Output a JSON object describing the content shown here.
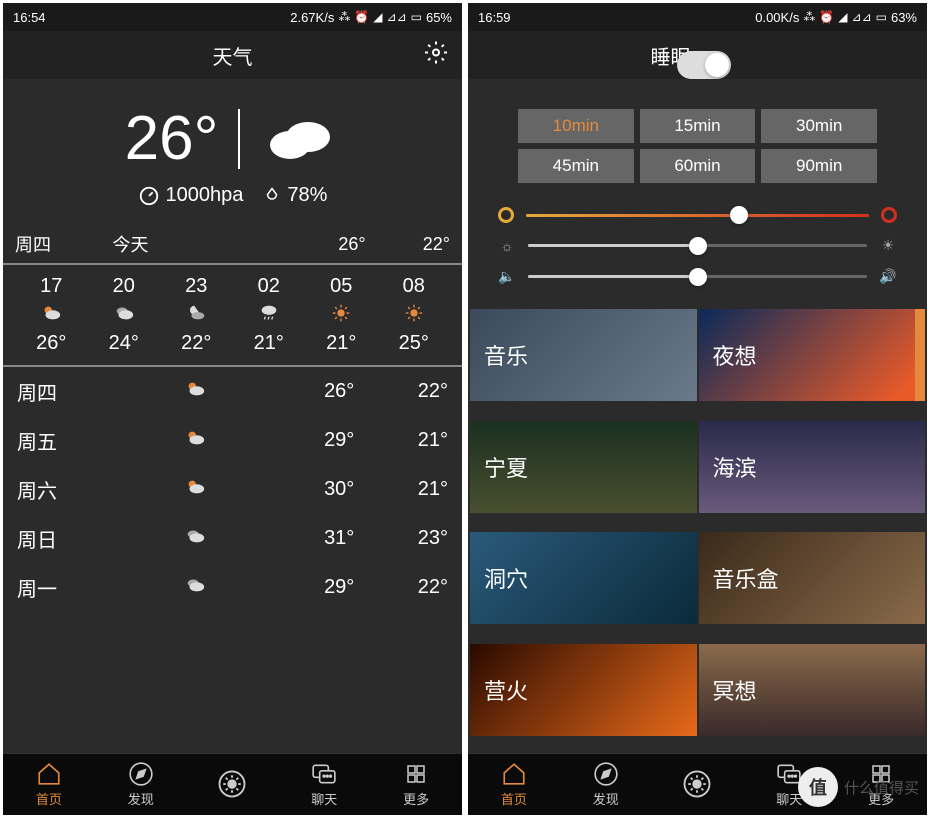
{
  "left": {
    "statusbar": {
      "time": "16:54",
      "speed": "2.67K/s",
      "battery": "65%"
    },
    "header": {
      "title": "天气"
    },
    "current": {
      "temp": "26°",
      "pressure": "1000hpa",
      "humidity": "78%"
    },
    "today": {
      "label_day": "周四",
      "label_today": "今天",
      "hi": "26°",
      "lo": "22°"
    },
    "hourly": [
      {
        "time": "17",
        "icon": "partly-sunny",
        "temp": "26°"
      },
      {
        "time": "20",
        "icon": "partly-cloudy",
        "temp": "24°"
      },
      {
        "time": "23",
        "icon": "night-cloudy",
        "temp": "22°"
      },
      {
        "time": "02",
        "icon": "rain",
        "temp": "21°"
      },
      {
        "time": "05",
        "icon": "sunny",
        "temp": "21°"
      },
      {
        "time": "08",
        "icon": "sunny",
        "temp": "25°"
      }
    ],
    "daily": [
      {
        "day": "周四",
        "icon": "partly-sunny",
        "hi": "26°",
        "lo": "22°"
      },
      {
        "day": "周五",
        "icon": "partly-sunny",
        "hi": "29°",
        "lo": "21°"
      },
      {
        "day": "周六",
        "icon": "partly-sunny",
        "hi": "30°",
        "lo": "21°"
      },
      {
        "day": "周日",
        "icon": "partly-cloudy",
        "hi": "31°",
        "lo": "23°"
      },
      {
        "day": "周一",
        "icon": "partly-cloudy",
        "hi": "29°",
        "lo": "22°"
      }
    ]
  },
  "right": {
    "statusbar": {
      "time": "16:59",
      "speed": "0.00K/s",
      "battery": "63%"
    },
    "header": {
      "title": "睡眠"
    },
    "timers": [
      "10min",
      "15min",
      "30min",
      "45min",
      "60min",
      "90min"
    ],
    "timer_active": 0,
    "sliders": [
      {
        "type": "color",
        "value": 62
      },
      {
        "type": "brightness",
        "value": 50
      },
      {
        "type": "volume",
        "value": 50
      }
    ],
    "sounds": [
      {
        "label": "音乐",
        "bg": "linear-gradient(135deg,#3a4a5a,#6a7a8a)"
      },
      {
        "label": "夜想",
        "bg": "linear-gradient(135deg,#0a2a5a,#e85a2a 90%)",
        "active": true
      },
      {
        "label": "宁夏",
        "bg": "linear-gradient(180deg,#1a3020,#4a5030)"
      },
      {
        "label": "海滨",
        "bg": "linear-gradient(180deg,#2a2a4a,#6a5a7a)"
      },
      {
        "label": "洞穴",
        "bg": "linear-gradient(135deg,#2a5a7a,#0a2a3a)"
      },
      {
        "label": "音乐盒",
        "bg": "linear-gradient(135deg,#3a2a1a,#8a6a4a)"
      },
      {
        "label": "营火",
        "bg": "linear-gradient(135deg,#2a0a00,#e86a1a)"
      },
      {
        "label": "冥想",
        "bg": "linear-gradient(180deg,#8a6a4a,#3a2a2a)"
      }
    ]
  },
  "nav": [
    {
      "label": "首页",
      "icon": "home"
    },
    {
      "label": "发现",
      "icon": "compass"
    },
    {
      "label": "",
      "icon": "sun"
    },
    {
      "label": "聊天",
      "icon": "chat"
    },
    {
      "label": "更多",
      "icon": "grid"
    }
  ],
  "watermark": {
    "badge": "值",
    "text": "什么值得买"
  }
}
